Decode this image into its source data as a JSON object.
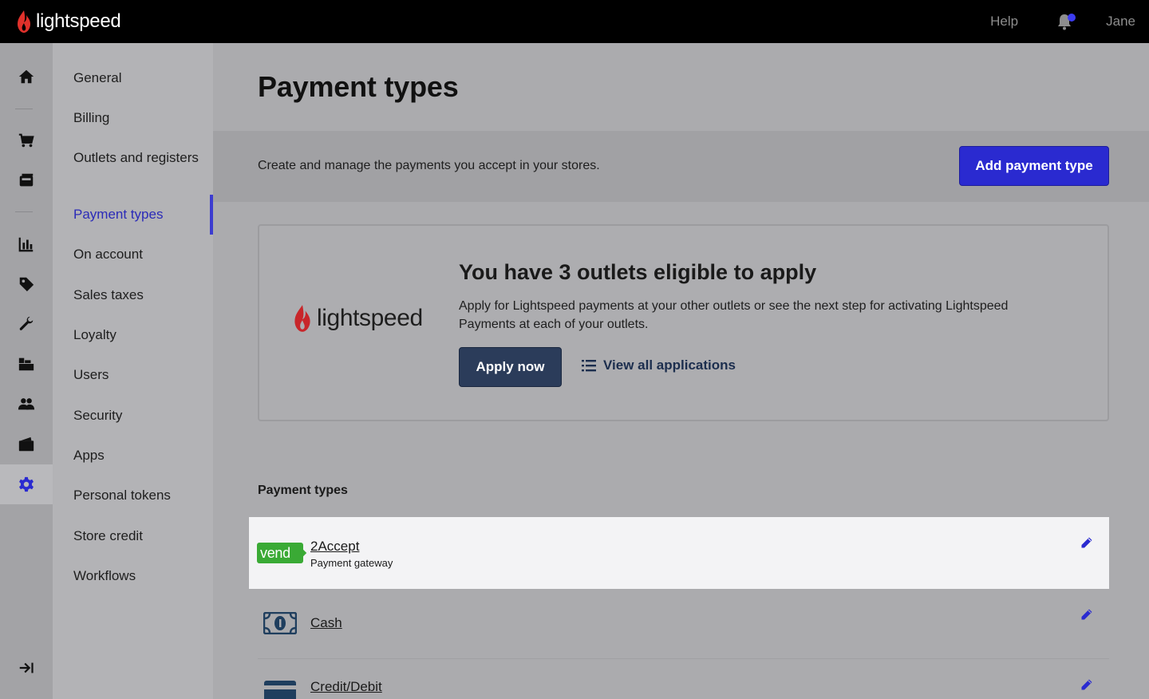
{
  "header": {
    "brand": "lightspeed",
    "help_label": "Help",
    "user_name": "Jane",
    "accent_color": "#3c3cf0"
  },
  "rail": {
    "icons": [
      "home-icon",
      "cart-icon",
      "register-icon",
      "reports-icon",
      "tag-icon",
      "wrench-icon",
      "inventory-icon",
      "customers-icon",
      "wallet-icon",
      "gear-icon",
      "expand-icon"
    ],
    "active": "gear-icon"
  },
  "sidebar": {
    "items": [
      {
        "label": "General"
      },
      {
        "label": "Billing"
      },
      {
        "label": "Outlets and registers"
      },
      {
        "label": "Payment types"
      },
      {
        "label": "On account"
      },
      {
        "label": "Sales taxes"
      },
      {
        "label": "Loyalty"
      },
      {
        "label": "Users"
      },
      {
        "label": "Security"
      },
      {
        "label": "Apps"
      },
      {
        "label": "Personal tokens"
      },
      {
        "label": "Store credit"
      },
      {
        "label": "Workflows"
      }
    ],
    "active": "Payment types"
  },
  "main": {
    "title": "Payment types",
    "description": "Create and manage the payments you accept in your stores.",
    "add_button": "Add payment type"
  },
  "promo": {
    "brand": "lightspeed",
    "title": "You have 3 outlets eligible to apply",
    "text": "Apply for Lightspeed payments at your other outlets or see the next step for activating Lightspeed Payments at each of your outlets.",
    "apply_button": "Apply now",
    "view_all_link": "View all applications"
  },
  "payment_types": {
    "section_label": "Payment types",
    "items": [
      {
        "name": "2Accept",
        "subtitle": "Payment gateway",
        "badge": "vend",
        "icon": "vend-logo"
      },
      {
        "name": "Cash",
        "icon": "cash-icon"
      },
      {
        "name": "Credit/Debit",
        "icon": "card-icon"
      }
    ]
  }
}
